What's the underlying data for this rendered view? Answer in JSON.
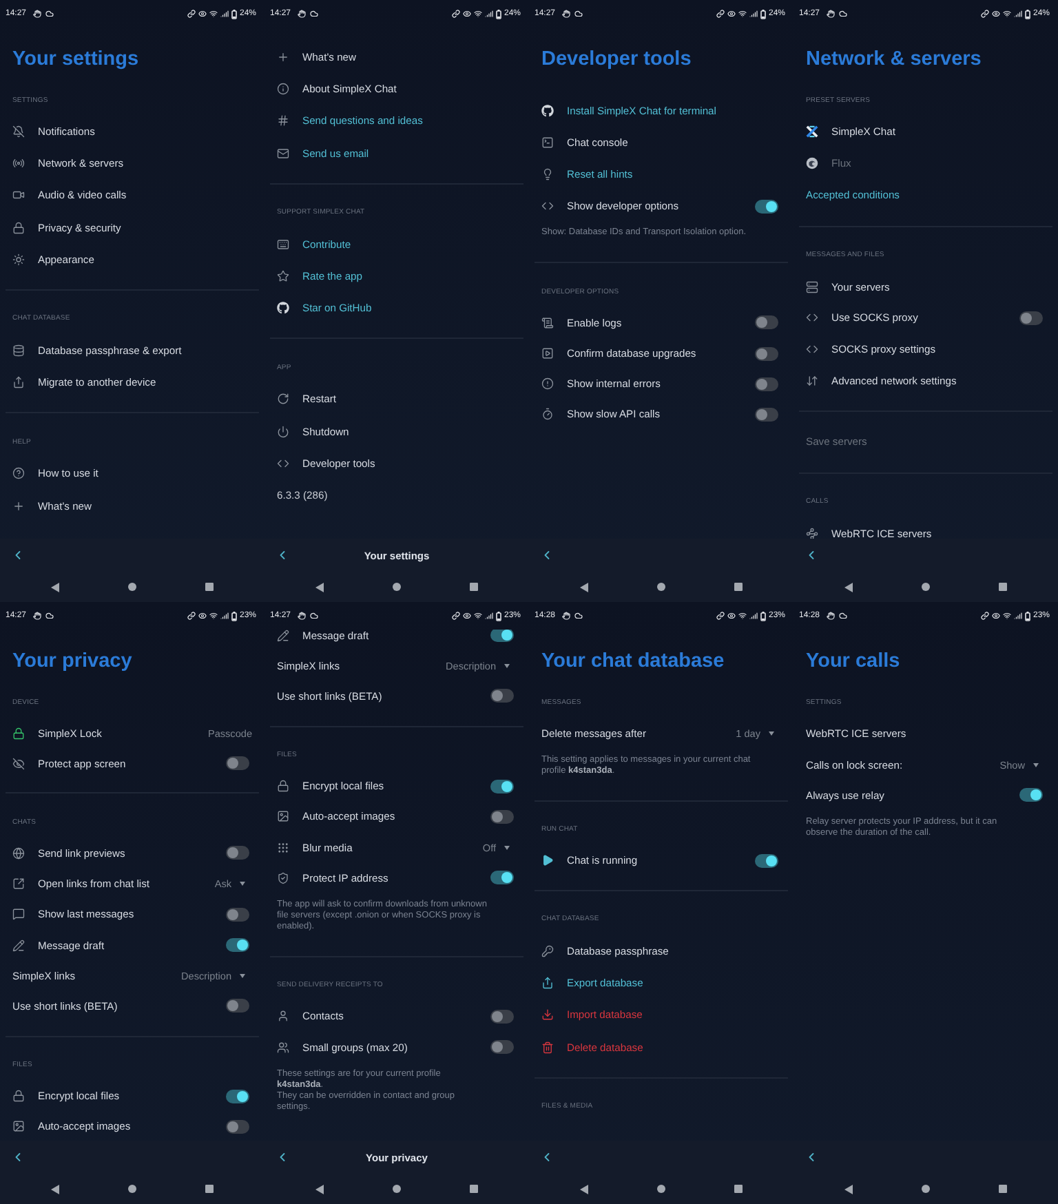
{
  "screens": [
    {
      "status_bar": {
        "time": "14:27",
        "battery": "24%"
      },
      "clipped_top": false,
      "title": "Your settings",
      "sections": [
        {
          "header": "SETTINGS",
          "items": [
            {
              "kind": "nav",
              "label": "Notifications"
            },
            {
              "kind": "nav",
              "label": "Network & servers"
            },
            {
              "kind": "nav",
              "label": "Audio & video calls"
            },
            {
              "kind": "nav",
              "label": "Privacy & security"
            },
            {
              "kind": "nav",
              "label": "Appearance"
            }
          ]
        },
        {
          "header": "CHAT DATABASE",
          "items": [
            {
              "kind": "nav",
              "label": "Database passphrase & export"
            },
            {
              "kind": "nav",
              "label": "Migrate to another device"
            }
          ]
        },
        {
          "header": "HELP",
          "items": [
            {
              "kind": "nav",
              "label": "How to use it"
            },
            {
              "kind": "nav",
              "label": "What's new"
            }
          ]
        }
      ]
    },
    {
      "status_bar": {
        "time": "14:27",
        "battery": "24%"
      },
      "clipped_top": false,
      "app_bar_title": "Your settings",
      "sections": [
        {
          "items": [
            {
              "kind": "nav",
              "label": "What's new"
            },
            {
              "kind": "nav",
              "label": "About SimpleX Chat"
            },
            {
              "kind": "link",
              "label": "Send questions and ideas"
            },
            {
              "kind": "link",
              "label": "Send us email"
            }
          ]
        },
        {
          "header": "SUPPORT SIMPLEX CHAT",
          "items": [
            {
              "kind": "link",
              "label": "Contribute"
            },
            {
              "kind": "link",
              "label": "Rate the app"
            },
            {
              "kind": "link",
              "label": "Star on GitHub"
            }
          ]
        },
        {
          "header": "APP",
          "items": [
            {
              "kind": "nav",
              "label": "Restart"
            },
            {
              "kind": "nav",
              "label": "Shutdown"
            },
            {
              "kind": "nav",
              "label": "Developer tools"
            },
            {
              "kind": "text",
              "label": "6.3.3 (286)"
            }
          ]
        }
      ]
    },
    {
      "status_bar": {
        "time": "14:27",
        "battery": "24%"
      },
      "clipped_top": false,
      "title": "Developer tools",
      "sections": [
        {
          "items": [
            {
              "kind": "link",
              "label": "Install SimpleX Chat for terminal"
            },
            {
              "kind": "nav",
              "label": "Chat console"
            },
            {
              "kind": "link",
              "label": "Reset all hints"
            },
            {
              "kind": "toggle",
              "label": "Show developer options",
              "on": true
            }
          ],
          "hint": [
            "Show: Database IDs and Transport Isolation option."
          ]
        },
        {
          "header": "DEVELOPER OPTIONS",
          "items": [
            {
              "kind": "toggle",
              "label": "Enable logs",
              "on": false
            },
            {
              "kind": "toggle",
              "label": "Confirm database upgrades",
              "on": false
            },
            {
              "kind": "toggle",
              "label": "Show internal errors",
              "on": false
            },
            {
              "kind": "toggle",
              "label": "Show slow API calls",
              "on": false
            }
          ]
        }
      ]
    },
    {
      "status_bar": {
        "time": "14:27",
        "battery": "24%"
      },
      "clipped_top": false,
      "title": "Network & servers",
      "sections": [
        {
          "header": "PRESET SERVERS",
          "items": [
            {
              "kind": "nav",
              "label": "SimpleX Chat"
            },
            {
              "kind": "inactive",
              "label": "Flux"
            },
            {
              "kind": "link",
              "label": "Accepted conditions"
            }
          ]
        },
        {
          "header": "MESSAGES AND FILES",
          "items": [
            {
              "kind": "nav",
              "label": "Your servers"
            },
            {
              "kind": "toggle",
              "label": "Use SOCKS proxy",
              "on": false
            },
            {
              "kind": "nav",
              "label": "SOCKS proxy settings"
            },
            {
              "kind": "nav",
              "label": "Advanced network settings"
            }
          ]
        },
        {
          "items": [
            {
              "kind": "inactive",
              "label": "Save servers"
            }
          ]
        },
        {
          "header": "CALLS",
          "items": [
            {
              "kind": "nav",
              "label": "WebRTC ICE servers"
            }
          ]
        }
      ]
    },
    {
      "status_bar": {
        "time": "14:27",
        "battery": "23%"
      },
      "clipped_top": false,
      "title": "Your privacy",
      "sections": [
        {
          "header": "DEVICE",
          "items": [
            {
              "kind": "value",
              "label": "SimpleX Lock",
              "value": "Passcode"
            },
            {
              "kind": "toggle",
              "label": "Protect app screen",
              "on": false
            }
          ]
        },
        {
          "header": "CHATS",
          "items": [
            {
              "kind": "toggle",
              "label": "Send link previews",
              "on": false
            },
            {
              "kind": "select",
              "label": "Open links from chat list",
              "value": "Ask"
            },
            {
              "kind": "toggle",
              "label": "Show last messages",
              "on": false
            },
            {
              "kind": "toggle",
              "label": "Message draft",
              "on": true
            },
            {
              "kind": "select",
              "label": "SimpleX links",
              "value": "Description"
            },
            {
              "kind": "toggle",
              "label": "Use short links (BETA)",
              "on": false
            }
          ]
        },
        {
          "header": "FILES",
          "items": [
            {
              "kind": "toggle",
              "label": "Encrypt local files",
              "on": true
            },
            {
              "kind": "toggle",
              "label": "Auto-accept images",
              "on": false
            }
          ]
        }
      ]
    },
    {
      "status_bar": {
        "time": "14:27",
        "battery": "23%"
      },
      "clipped_top": true,
      "app_bar_title": "Your privacy",
      "sections": [
        {
          "items": [
            {
              "kind": "toggle",
              "label": "Message draft",
              "on": true
            },
            {
              "kind": "select",
              "label": "SimpleX links",
              "value": "Description"
            },
            {
              "kind": "toggle",
              "label": "Use short links (BETA)",
              "on": false
            }
          ]
        },
        {
          "header": "FILES",
          "items": [
            {
              "kind": "toggle",
              "label": "Encrypt local files",
              "on": true
            },
            {
              "kind": "toggle",
              "label": "Auto-accept images",
              "on": false
            },
            {
              "kind": "select",
              "label": "Blur media",
              "value": "Off"
            },
            {
              "kind": "toggle",
              "label": "Protect IP address",
              "on": true
            }
          ],
          "hint": [
            "The app will ask to confirm downloads from unknown file servers (except .onion or when SOCKS proxy is enabled)."
          ]
        },
        {
          "header": "SEND DELIVERY RECEIPTS TO",
          "items": [
            {
              "kind": "toggle",
              "label": "Contacts",
              "on": false
            },
            {
              "kind": "toggle",
              "label": "Small groups (max 20)",
              "on": false
            }
          ],
          "hint": [
            "These settings are for your current profile **k4stan3da**.",
            "They can be overridden in contact and group settings."
          ]
        }
      ]
    },
    {
      "status_bar": {
        "time": "14:28",
        "battery": "23%"
      },
      "clipped_top": false,
      "title": "Your chat database",
      "sections": [
        {
          "header": "MESSAGES",
          "items": [
            {
              "kind": "select",
              "label": "Delete messages after",
              "value": "1 day"
            }
          ],
          "hint": [
            "This setting applies to messages in your current chat profile **k4stan3da**."
          ]
        },
        {
          "header": "RUN CHAT",
          "items": [
            {
              "kind": "toggle",
              "label": "Chat is running",
              "on": true
            }
          ]
        },
        {
          "header": "CHAT DATABASE",
          "items": [
            {
              "kind": "nav",
              "label": "Database passphrase"
            },
            {
              "kind": "link",
              "label": "Export database"
            },
            {
              "kind": "danger",
              "label": "Import database"
            },
            {
              "kind": "danger",
              "label": "Delete database"
            }
          ]
        },
        {
          "header": "FILES & MEDIA"
        }
      ]
    },
    {
      "status_bar": {
        "time": "14:28",
        "battery": "23%"
      },
      "clipped_top": false,
      "title": "Your calls",
      "sections": [
        {
          "header": "SETTINGS",
          "items": [
            {
              "kind": "nav",
              "label": "WebRTC ICE servers"
            },
            {
              "kind": "select",
              "label": "Calls on lock screen:",
              "value": "Show"
            },
            {
              "kind": "toggle",
              "label": "Always use relay",
              "on": true
            }
          ],
          "hint": [
            "Relay server protects your IP address, but it can observe the duration of the call."
          ]
        }
      ]
    }
  ]
}
